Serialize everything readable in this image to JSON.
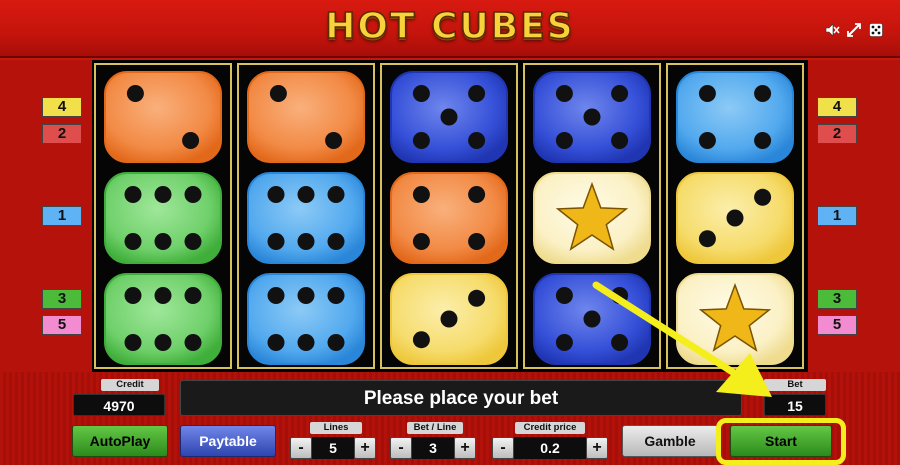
{
  "header": {
    "title": "HOT CUBES",
    "icons": [
      "sound-off-icon",
      "fullscreen-exit-icon",
      "settings-icon"
    ]
  },
  "paylines": {
    "left": [
      {
        "label": "4",
        "color": "#f1e04a"
      },
      {
        "label": "2",
        "color": "#e04d4d"
      },
      {
        "label": "1",
        "color": "#5fb3f4"
      },
      {
        "label": "3",
        "color": "#4cbb3a"
      },
      {
        "label": "5",
        "color": "#f28bd0"
      }
    ],
    "right": [
      {
        "label": "4",
        "color": "#f1e04a"
      },
      {
        "label": "2",
        "color": "#e04d4d"
      },
      {
        "label": "1",
        "color": "#5fb3f4"
      },
      {
        "label": "3",
        "color": "#4cbb3a"
      },
      {
        "label": "5",
        "color": "#f28bd0"
      }
    ]
  },
  "reels": [
    [
      {
        "color": "orange",
        "pips": 2
      },
      {
        "color": "green",
        "pips": 6
      },
      {
        "color": "green",
        "pips": 6
      }
    ],
    [
      {
        "color": "orange",
        "pips": 2
      },
      {
        "color": "lightblue",
        "pips": 6
      },
      {
        "color": "lightblue",
        "pips": 6
      }
    ],
    [
      {
        "color": "blue",
        "pips": 5
      },
      {
        "color": "orange",
        "pips": 4
      },
      {
        "color": "yellow",
        "pips": 3
      }
    ],
    [
      {
        "color": "blue",
        "pips": 5
      },
      {
        "color": "star",
        "pips": 0
      },
      {
        "color": "blue",
        "pips": 5
      }
    ],
    [
      {
        "color": "lightblue",
        "pips": 4
      },
      {
        "color": "yellow",
        "pips": 3
      },
      {
        "color": "star",
        "pips": 0
      }
    ]
  ],
  "credit": {
    "label": "Credit",
    "value": "4970"
  },
  "message": "Please place your bet",
  "bet": {
    "label": "Bet",
    "value": "15"
  },
  "buttons": {
    "autoplay": "AutoPlay",
    "paytable": "Paytable",
    "gamble": "Gamble",
    "start": "Start"
  },
  "steppers": {
    "lines": {
      "label": "Lines",
      "value": "5"
    },
    "bet_per_line": {
      "label": "Bet / Line",
      "value": "3"
    },
    "credit_price": {
      "label": "Credit price",
      "value": "0.2"
    }
  },
  "stepper_symbols": {
    "minus": "-",
    "plus": "+"
  },
  "colors": {
    "highlight": "#f4ee1c",
    "frame": "#c4140c",
    "title": "#f7d23a"
  }
}
